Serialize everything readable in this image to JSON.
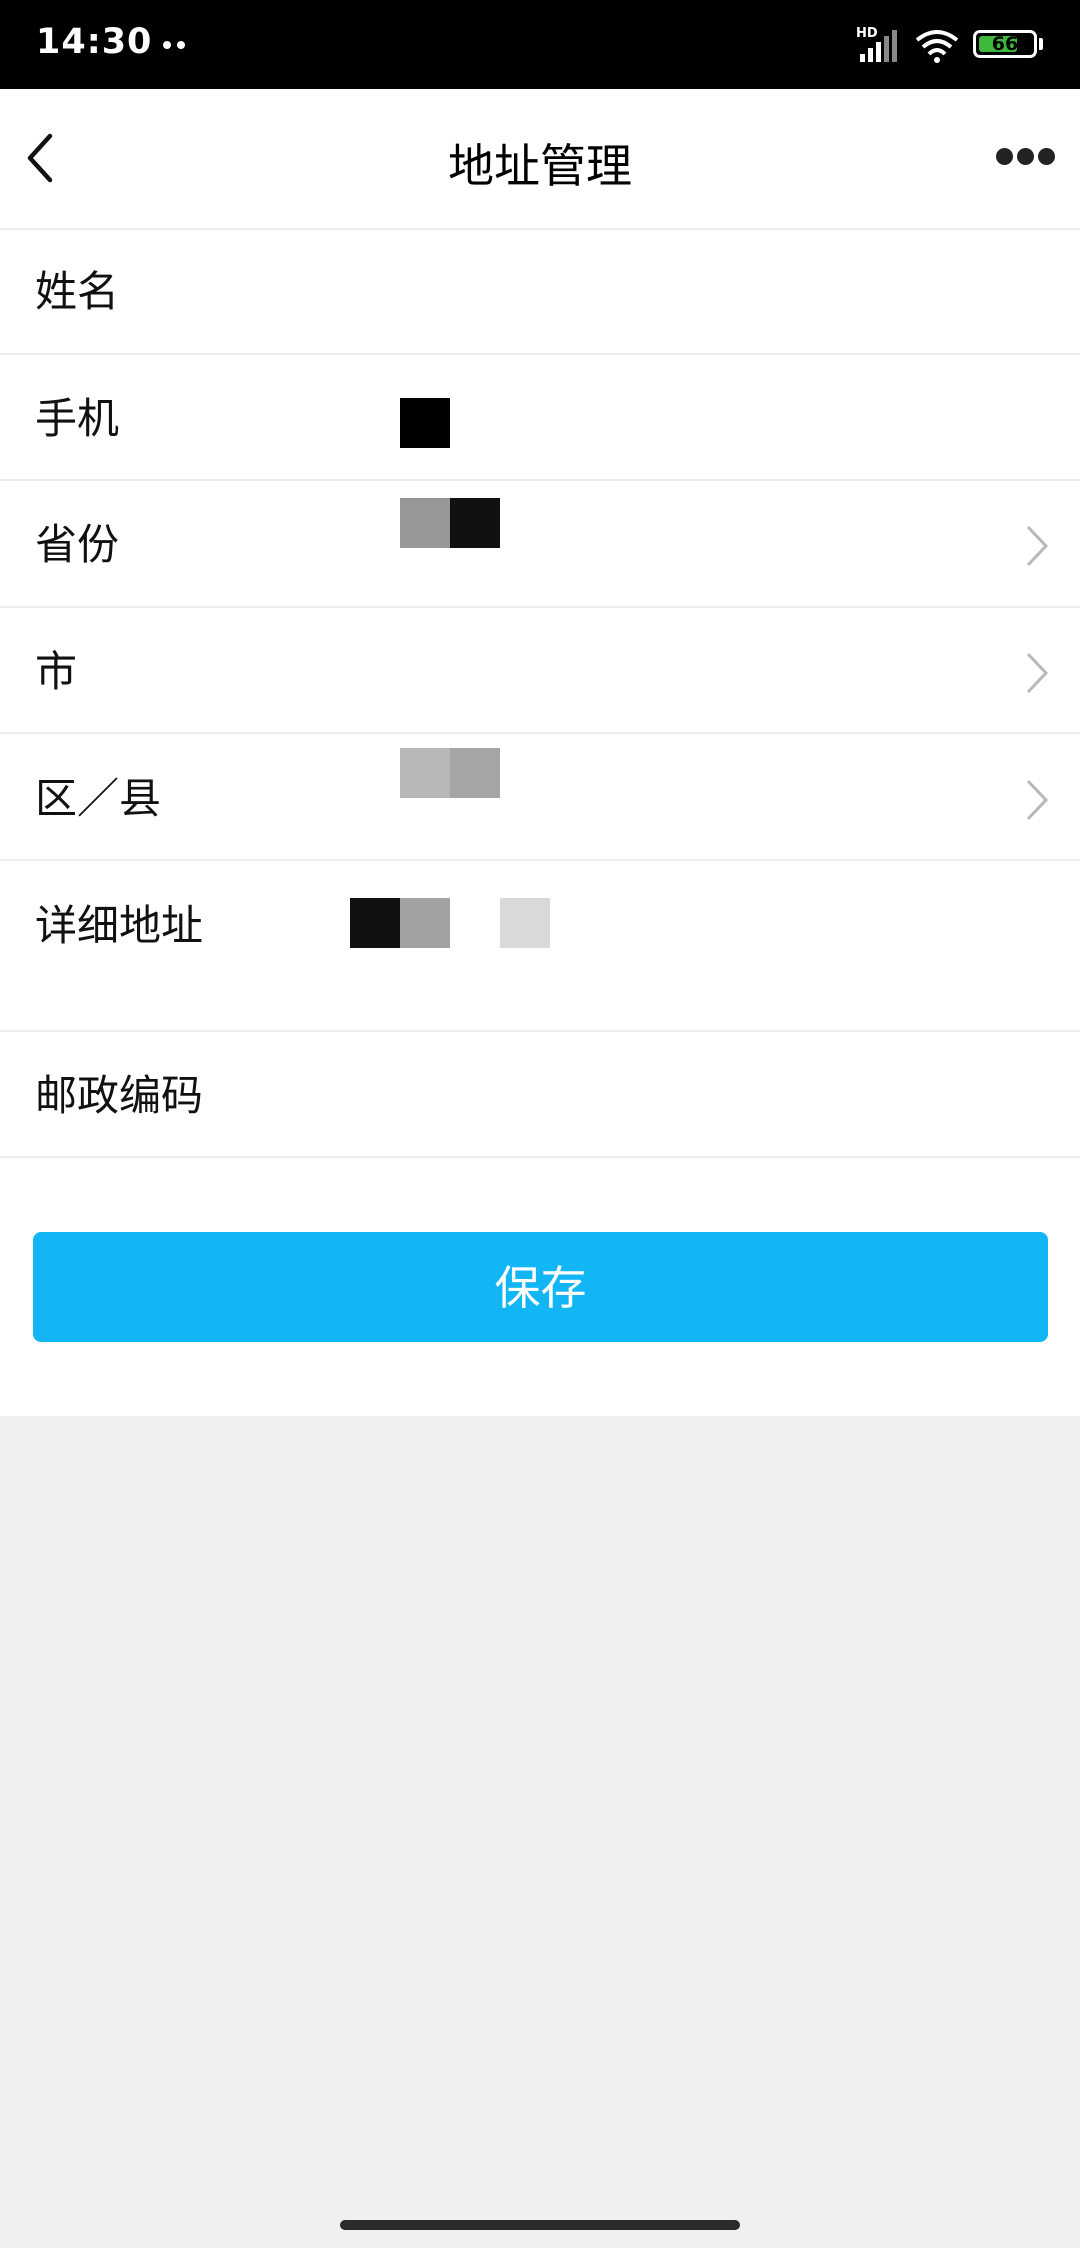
{
  "status_bar": {
    "time": "14:30",
    "network_label": "HD",
    "battery_level": "66",
    "battery_color": "#3cb83c"
  },
  "nav": {
    "title": "地址管理",
    "back_icon": "chevron-left-icon",
    "more_icon": "more-dots-icon"
  },
  "form": {
    "rows": [
      {
        "label": "姓名",
        "value": "",
        "has_chevron": false
      },
      {
        "label": "手机",
        "value": "",
        "has_chevron": false
      },
      {
        "label": "省份",
        "value": "",
        "has_chevron": true
      },
      {
        "label": "市",
        "value": "",
        "has_chevron": true
      },
      {
        "label": "区／县",
        "value": "",
        "has_chevron": true
      },
      {
        "label": "详细地址",
        "value": "",
        "has_chevron": false
      },
      {
        "label": "邮政编码",
        "value": "",
        "has_chevron": false
      }
    ]
  },
  "save_button": {
    "label": "保存",
    "color": "#13b6f5"
  },
  "colors": {
    "background": "#f0f0f0",
    "surface": "#ffffff",
    "divider": "#ececec"
  }
}
